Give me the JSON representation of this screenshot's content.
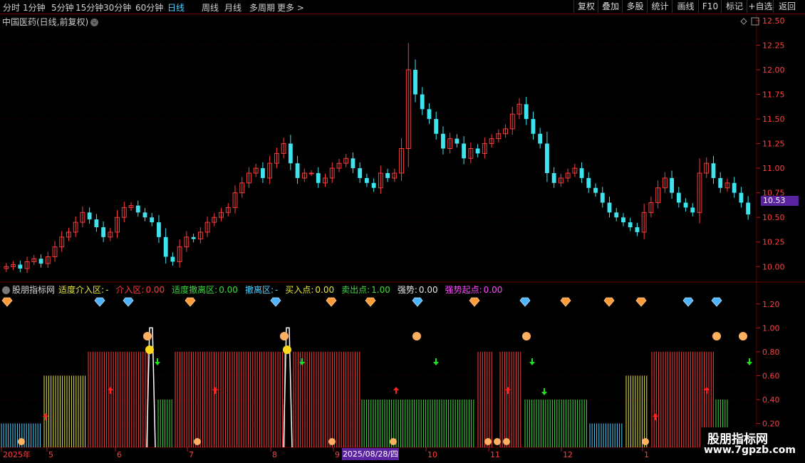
{
  "toolbar": {
    "periods": [
      "分时",
      "1分钟",
      "5分钟",
      "15分钟",
      "30分钟",
      "60分钟",
      "日线",
      "周线",
      "月线",
      "多周期",
      "更多 >"
    ],
    "active_period": "日线",
    "buttons": [
      "复权",
      "叠加",
      "多股",
      "统计",
      "画线",
      "F10",
      "标记",
      "+自选",
      "返回"
    ]
  },
  "main_chart": {
    "title": "中国医药(日线,前复权)",
    "last_price": "10.53",
    "y_ticks": [
      "12.50",
      "12.25",
      "12.00",
      "11.75",
      "11.50",
      "11.25",
      "11.00",
      "10.75",
      "10.50",
      "10.25",
      "10.00"
    ],
    "y_range": [
      9.85,
      12.55
    ],
    "colors": {
      "up": "#ff3c3c",
      "down": "#3fe3ee"
    }
  },
  "indicator": {
    "name": "股朋指标网",
    "fields": [
      {
        "label": "适度介入区:",
        "value": "-",
        "color": "#e8e83c"
      },
      {
        "label": "介入区:",
        "value": "0.00",
        "color": "#ff3c3c"
      },
      {
        "label": "适度撤离区:",
        "value": "0.00",
        "color": "#3cdc3c"
      },
      {
        "label": "撤离区:",
        "value": "-",
        "color": "#4fd0ff"
      },
      {
        "label": "买入点:",
        "value": "0.00",
        "color": "#e8e83c"
      },
      {
        "label": "卖出点:",
        "value": "1.00",
        "color": "#3cdc3c"
      },
      {
        "label": "强势:",
        "value": "0.00",
        "color": "#e8e8e8"
      },
      {
        "label": "强势起点:",
        "value": "0.00",
        "color": "#ff4cff"
      }
    ],
    "y_ticks": [
      "1.20",
      "1.00",
      "0.80",
      "0.60",
      "0.40",
      "0.20"
    ],
    "y_range": [
      0,
      1.3
    ]
  },
  "x_axis": {
    "labels": [
      "2025年",
      "5",
      "6",
      "7",
      "8",
      "9",
      "10",
      "11",
      "12",
      "1"
    ],
    "selected_date": "2025/08/28/四"
  },
  "watermark": {
    "line1": "股朋指标网",
    "line2": "www.7gpzb.com"
  },
  "chart_data": {
    "type": "candlestick",
    "symbol": "中国医药",
    "period": "日线",
    "y_range": [
      9.85,
      12.55
    ],
    "candles_close_approx": [
      10.0,
      10.02,
      9.98,
      10.05,
      10.08,
      10.03,
      10.1,
      10.2,
      10.3,
      10.35,
      10.45,
      10.55,
      10.48,
      10.4,
      10.3,
      10.35,
      10.5,
      10.6,
      10.62,
      10.55,
      10.5,
      10.45,
      10.3,
      10.1,
      10.05,
      10.2,
      10.3,
      10.28,
      10.35,
      10.45,
      10.5,
      10.55,
      10.6,
      10.75,
      10.85,
      10.95,
      11.0,
      10.9,
      11.05,
      11.15,
      11.25,
      11.05,
      10.9,
      10.95,
      10.95,
      10.85,
      10.9,
      11.0,
      11.05,
      11.1,
      11.0,
      10.9,
      10.85,
      10.8,
      10.95,
      10.9,
      10.95,
      11.2,
      12.0,
      11.75,
      11.6,
      11.5,
      11.35,
      11.2,
      11.3,
      11.25,
      11.1,
      11.2,
      11.15,
      11.25,
      11.3,
      11.35,
      11.4,
      11.55,
      11.65,
      11.5,
      11.35,
      11.25,
      10.95,
      10.85,
      10.9,
      10.95,
      11.0,
      10.9,
      10.8,
      10.75,
      10.65,
      10.55,
      10.5,
      10.45,
      10.4,
      10.35,
      10.55,
      10.65,
      10.8,
      10.9,
      10.75,
      10.65,
      10.6,
      10.55,
      10.95,
      11.05,
      10.9,
      10.8,
      10.85,
      10.75,
      10.65,
      10.53
    ]
  }
}
